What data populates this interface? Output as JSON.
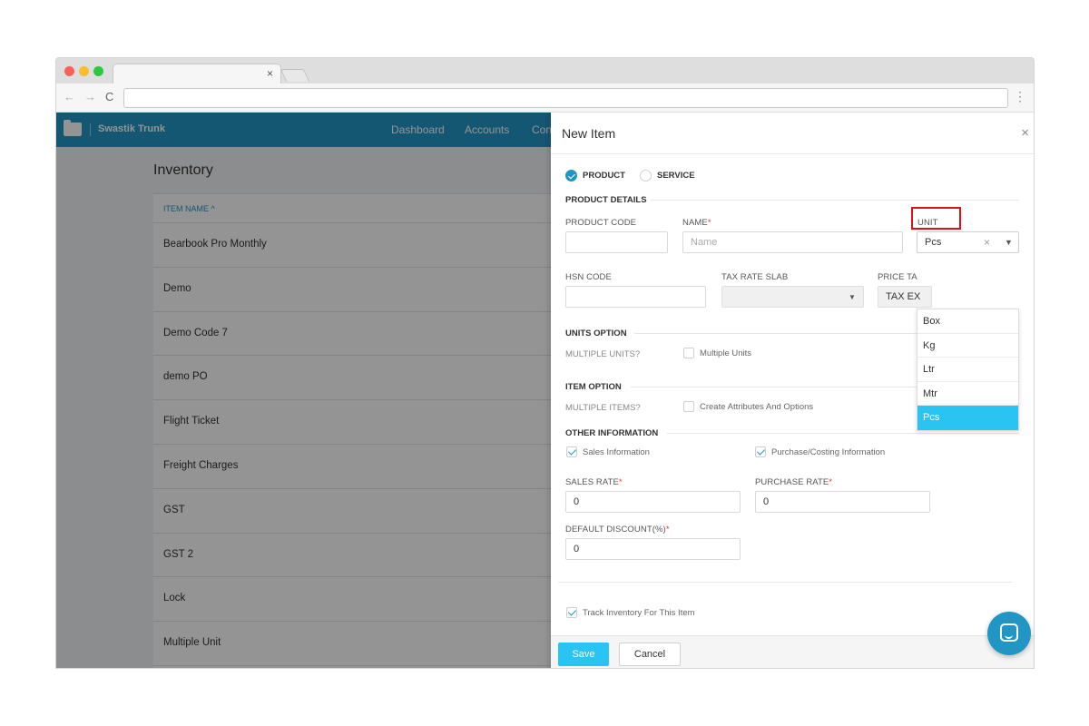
{
  "browser": {
    "tab_close": "×",
    "back_icon": "←",
    "forward_icon": "→",
    "reload_icon": "C",
    "menu_icon": "⋮"
  },
  "app": {
    "brand": "Swastik Trunk",
    "nav": [
      "Dashboard",
      "Accounts",
      "Con"
    ],
    "accent_color": "#2196c4"
  },
  "inventory": {
    "title": "Inventory",
    "column_header": "ITEM NAME ^",
    "rows": [
      "Bearbook Pro Monthly",
      "Demo",
      "Demo Code 7",
      "demo PO",
      "Flight Ticket",
      "Freight Charges",
      "GST",
      "GST 2",
      "Lock",
      "Multiple Unit"
    ]
  },
  "drawer": {
    "title": "New Item",
    "close_icon": "×",
    "type_options": {
      "product": "PRODUCT",
      "service": "SERVICE",
      "selected": "PRODUCT"
    },
    "product_details": {
      "section": "PRODUCT DETAILS",
      "product_code_label": "PRODUCT CODE",
      "product_code_value": "",
      "name_label": "NAME",
      "required_mark": "*",
      "name_placeholder": "Name",
      "unit_label": "UNIT",
      "unit_value": "Pcs",
      "unit_clear": "×",
      "select_arrow": "▼",
      "hsn_label": "HSN CODE",
      "tax_label": "TAX RATE SLAB",
      "price_tax_label": "PRICE TA",
      "price_tax_value": "TAX EX"
    },
    "unit_options": [
      "Box",
      "Kg",
      "Ltr",
      "Mtr",
      "Pcs"
    ],
    "units_option": {
      "section": "UNITS OPTION",
      "label": "MULTIPLE UNITS?",
      "checkbox_label": "Multiple Units",
      "checked": false
    },
    "item_option": {
      "section": "ITEM OPTION",
      "label": "MULTIPLE ITEMS?",
      "checkbox_label": "Create Attributes And Options",
      "checked": false
    },
    "other_info": {
      "section": "OTHER INFORMATION",
      "sales_info": "Sales Information",
      "purchase_info": "Purchase/Costing Information",
      "sales_rate_label": "SALES RATE",
      "sales_rate_value": "0",
      "purchase_rate_label": "PURCHASE RATE",
      "purchase_rate_value": "0",
      "discount_label": "DEFAULT DISCOUNT(%)",
      "discount_value": "0"
    },
    "track_inventory": "Track Inventory For This Item",
    "save_label": "Save",
    "cancel_label": "Cancel"
  }
}
